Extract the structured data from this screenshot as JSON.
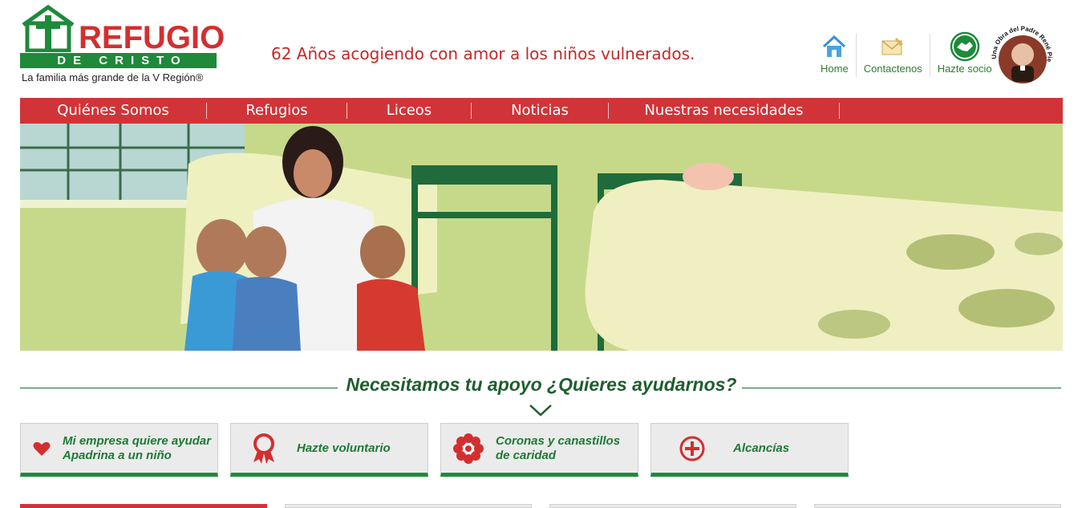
{
  "header": {
    "logo": {
      "brand": "REFUGIO",
      "band": "DE CRISTO",
      "subtitle": "La familia más grande de la V Región®"
    },
    "tagline": "62 Años acogiendo con amor a los niños vulnerados.",
    "links": [
      {
        "label": "Home",
        "icon": "house-icon"
      },
      {
        "label": "Contactenos",
        "icon": "envelope-icon"
      },
      {
        "label": "Hazte socio",
        "icon": "handshake-icon"
      }
    ],
    "badge_text": "Una Obra del Padre René Pienovi"
  },
  "nav": {
    "items": [
      "Quiénes Somos",
      "Refugios",
      "Liceos",
      "Noticias",
      "Nuestras necesidades"
    ]
  },
  "support": {
    "title": "Necesitamos tu apoyo ¿Quieres ayudarnos?"
  },
  "cards": [
    {
      "lines": [
        "Mi empresa quiere ayudar",
        "Apadrina a un niño"
      ],
      "icon": "heart-icon"
    },
    {
      "lines": [
        "Hazte voluntario"
      ],
      "icon": "ribbon-icon"
    },
    {
      "lines": [
        "Coronas y canastillos",
        "de caridad"
      ],
      "icon": "flower-icon"
    },
    {
      "lines": [
        "Alcancías"
      ],
      "icon": "plus-circle-icon"
    }
  ],
  "colors": {
    "brand_red": "#d13438",
    "brand_green": "#1e8a3a",
    "heading_green": "#1e5e2e"
  }
}
